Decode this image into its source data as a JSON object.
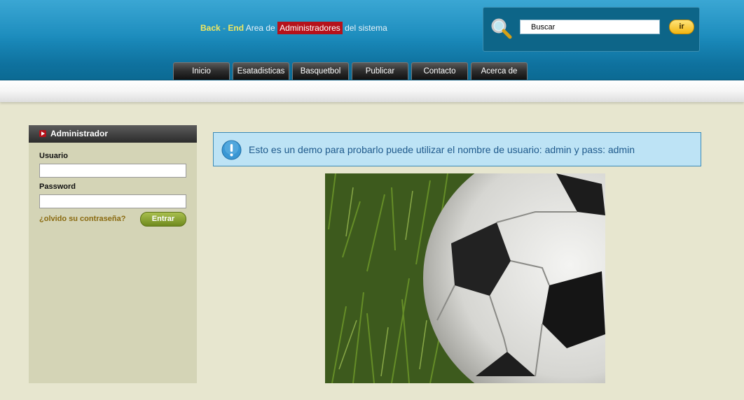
{
  "header": {
    "title_back": "Back",
    "title_dash": " - ",
    "title_end": "End",
    "title_area": " Area de ",
    "title_admins": "Administradores",
    "title_system": " del sistema"
  },
  "search": {
    "value": "Buscar",
    "button_label": "ir"
  },
  "nav": {
    "items": [
      {
        "label": "Inicio"
      },
      {
        "label": "Esatadisticas"
      },
      {
        "label": "Basquetbol"
      },
      {
        "label": "Publicar"
      },
      {
        "label": "Contacto"
      },
      {
        "label": "Acerca de"
      }
    ]
  },
  "sidebar": {
    "title": "Administrador",
    "user_label": "Usuario",
    "pass_label": "Password",
    "forgot_link": "¿olvido su contraseña?",
    "submit_label": "Entrar"
  },
  "info": {
    "message": "Esto es un demo para probarlo puede utilizar el nombre de usuario: admin y pass: admin"
  },
  "colors": {
    "header_blue": "#1b8cbd",
    "accent_yellow": "#f2e860",
    "badge_red": "#b5121b",
    "page_bg": "#e7e6cf",
    "sidebar_bg": "#d4d4b6",
    "info_bg": "#bde3f5",
    "button_green": "#7f9a28"
  },
  "icons": {
    "search": "magnifier-icon",
    "info": "exclamation-icon",
    "sidebar_bullet": "play-bullet-icon"
  }
}
